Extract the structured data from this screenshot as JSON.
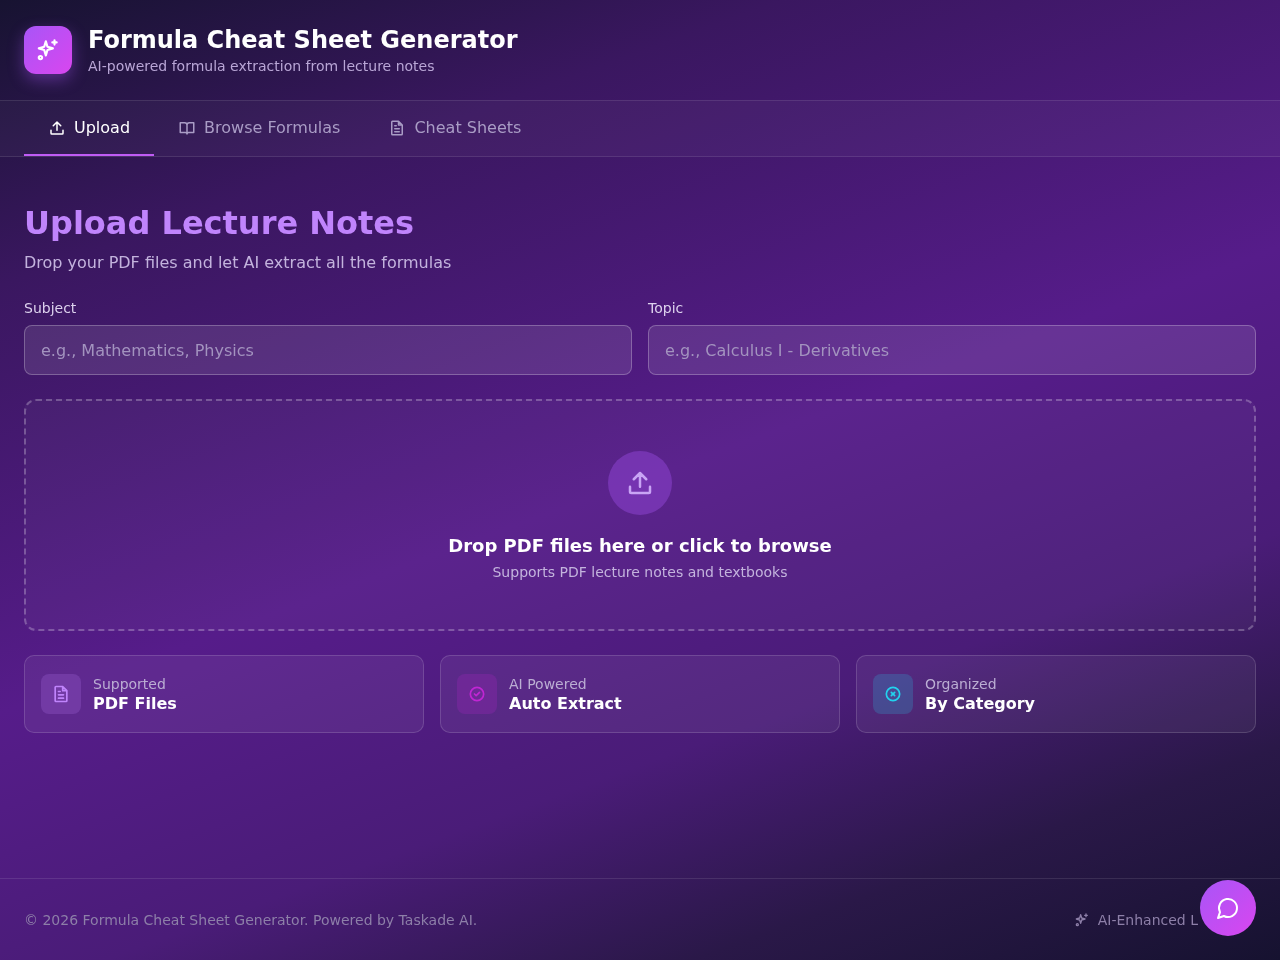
{
  "header": {
    "title": "Formula Cheat Sheet Generator",
    "subtitle": "AI-powered formula extraction from lecture notes"
  },
  "tabs": [
    {
      "label": "Upload",
      "selected": true
    },
    {
      "label": "Browse Formulas",
      "selected": false
    },
    {
      "label": "Cheat Sheets",
      "selected": false
    }
  ],
  "page": {
    "title": "Upload Lecture Notes",
    "subtitle": "Drop your PDF files and let AI extract all the formulas"
  },
  "fields": [
    {
      "label": "Subject",
      "placeholder": "e.g., Mathematics, Physics"
    },
    {
      "label": "Topic",
      "placeholder": "e.g., Calculus I - Derivatives"
    }
  ],
  "dropzone": {
    "title": "Drop PDF files here or click to browse",
    "hint": "Supports PDF lecture notes and textbooks"
  },
  "features": [
    {
      "caption": "Supported",
      "title": "PDF Files",
      "color": "#c084fc"
    },
    {
      "caption": "AI Powered",
      "title": "Auto Extract",
      "color": "#c026d3"
    },
    {
      "caption": "Organized",
      "title": "By Category",
      "color": "#22d3ee"
    }
  ],
  "footer": {
    "copyright": "© 2026 Formula Cheat Sheet Generator. Powered by Taskade AI.",
    "badge": "AI-Enhanced L"
  }
}
